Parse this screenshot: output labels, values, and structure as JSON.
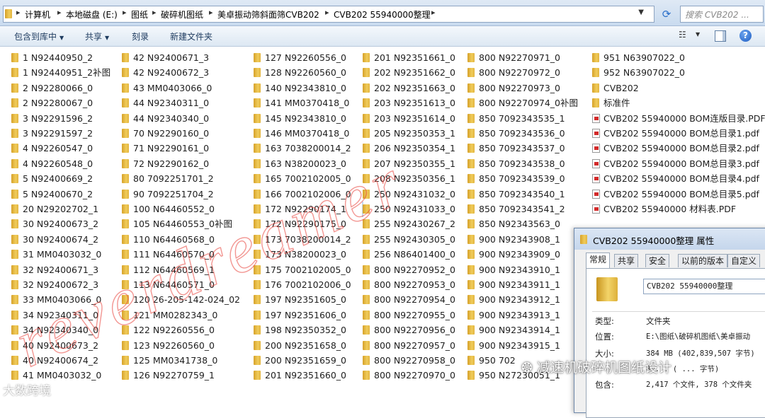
{
  "address_bar": {
    "crumbs": [
      "计算机",
      "本地磁盘 (E:)",
      "图纸",
      "破碎机图纸",
      "美卓振动筛斜面筛CVB202",
      "CVB202 55940000整理"
    ],
    "search_placeholder": "搜索 CVB202 ..."
  },
  "toolbar": {
    "include_library": "包含到库中",
    "share": "共享",
    "burn": "刻录",
    "new_folder": "新建文件夹"
  },
  "columns": [
    [
      "1 N92440950_2",
      "1 N92440951_2补图",
      "2 N92280066_0",
      "2 N92280067_0",
      "3 N92291596_2",
      "3 N92291597_2",
      "4 N92260547_0",
      "4 N92260548_0",
      "5 N92400669_2",
      "5 N92400670_2",
      "20 N29202702_1",
      "30 N92400673_2",
      "30 N92400674_2",
      "31 MM0403032_0",
      "32 N92400671_3",
      "32 N92400672_3",
      "33 MM0403066_0",
      "34 N92340311_0",
      "34 N92340340_0",
      "40 N92400673_2",
      "40 N92400674_2",
      "41 MM0403032_0"
    ],
    [
      "42 N92400671_3",
      "42 N92400672_3",
      "43 MM0403066_0",
      "44 N92340311_0",
      "44 N92340340_0",
      "70 N92290160_0",
      "71 N92290161_0",
      "72 N92290162_0",
      "80 7092251701_2",
      "90 7092251704_2",
      "100 N64460552_0",
      "105 N64460553_0补图",
      "110 N64460568_0",
      "111 N64460570_0",
      "112 N64460569_1",
      "113 N64460571_0",
      "120 26-205-142-024_02",
      "121 MM0282343_0",
      "122 N92260556_0",
      "123 N92260560_0",
      "125 MM0341738_0",
      "126 N92270759_1"
    ],
    [
      "127 N92260556_0",
      "128 N92260560_0",
      "140 N92343810_0",
      "141 MM0370418_0",
      "145 N92343810_0",
      "146 MM0370418_0",
      "163 7038200014_2",
      "163 N38200023_0",
      "165 7002102005_0",
      "166 7002102006_0",
      "172 N92290174_1",
      "172 N92290175_0",
      "173 7038200014_2",
      "173 N38200023_0",
      "175 7002102005_0",
      "176 7002102006_0",
      "197 N92351605_0",
      "197 N92351606_0",
      "198 N92350352_0",
      "200 N92351658_0",
      "200 N92351659_0",
      "201 N92351660_0"
    ],
    [
      "201 N92351661_0",
      "202 N92351662_0",
      "202 N92351663_0",
      "203 N92351613_0",
      "203 N92351614_0",
      "205 N92350353_1",
      "206 N92350354_1",
      "207 N92350355_1",
      "208 N92350356_1",
      "250 N92431032_0",
      "250 N92431033_0",
      "255 N92430267_2",
      "255 N92430305_0",
      "256 N86401400_0",
      "800 N92270952_0",
      "800 N92270953_0",
      "800 N92270954_0",
      "800 N92270955_0",
      "800 N92270956_0",
      "800 N92270957_0",
      "800 N92270958_0",
      "800 N92270970_0"
    ],
    [
      "800 N92270971_0",
      "800 N92270972_0",
      "800 N92270973_0",
      "800 N92270974_0补图",
      "850 7092343535_1",
      "850 7092343536_0",
      "850 7092343537_0",
      "850 7092343538_0",
      "850 7092343539_0",
      "850 7092343540_1",
      "850 7092343541_2",
      "850 N92343563_0",
      "900 N92343908_1",
      "900 N92343909_0",
      "900 N92343910_1",
      "900 N92343911_1",
      "900 N92343912_1",
      "900 N92343913_1",
      "900 N92343914_1",
      "900 N92343915_1",
      "950 702",
      "950 N27230051_1"
    ],
    [
      "951 N63907022_0",
      "952 N63907022_0",
      "CVB202",
      "标准件",
      "CVB202 55940000 BOM连版目录.PDF",
      "CVB202 55940000 BOM总目录1.pdf",
      "CVB202 55940000 BOM总目录2.pdf",
      "CVB202 55940000 BOM总目录3.pdf",
      "CVB202 55940000 BOM总目录4.pdf",
      "CVB202 55940000 BOM总目录5.pdf",
      "CVB202 55940000 材料表.PDF"
    ]
  ],
  "file_types_col6": [
    "folder",
    "folder",
    "folder",
    "folder",
    "pdf",
    "pdf",
    "pdf",
    "pdf",
    "pdf",
    "pdf",
    "pdf"
  ],
  "properties_dialog": {
    "title": "CVB202 55940000整理 属性",
    "tabs": [
      "常规",
      "共享",
      "安全",
      "以前的版本",
      "自定义"
    ],
    "active_tab": "常规",
    "folder_name": "CVB202 55940000整理",
    "type_label": "类型:",
    "type_value": "文件夹",
    "location_label": "位置:",
    "location_value": "E:\\图纸\\破碎机图纸\\美卓振动",
    "size_label": "大小:",
    "size_value": "384 MB (402,839,507 字节)",
    "disk_size_value": "8,... ( ... 字节)",
    "contains_label": "包含:",
    "contains_value": "2,417 个文件, 378 个文件夹"
  },
  "watermarks": {
    "diagonal_text": "reverdreamer",
    "logo_left": "大数跨境",
    "logo_right": "减速机破碎机图纸设计"
  },
  "colors": {
    "watermark": "#e8423a",
    "folder": "#e6b83c",
    "toolbar_text": "#1e3b5f"
  }
}
